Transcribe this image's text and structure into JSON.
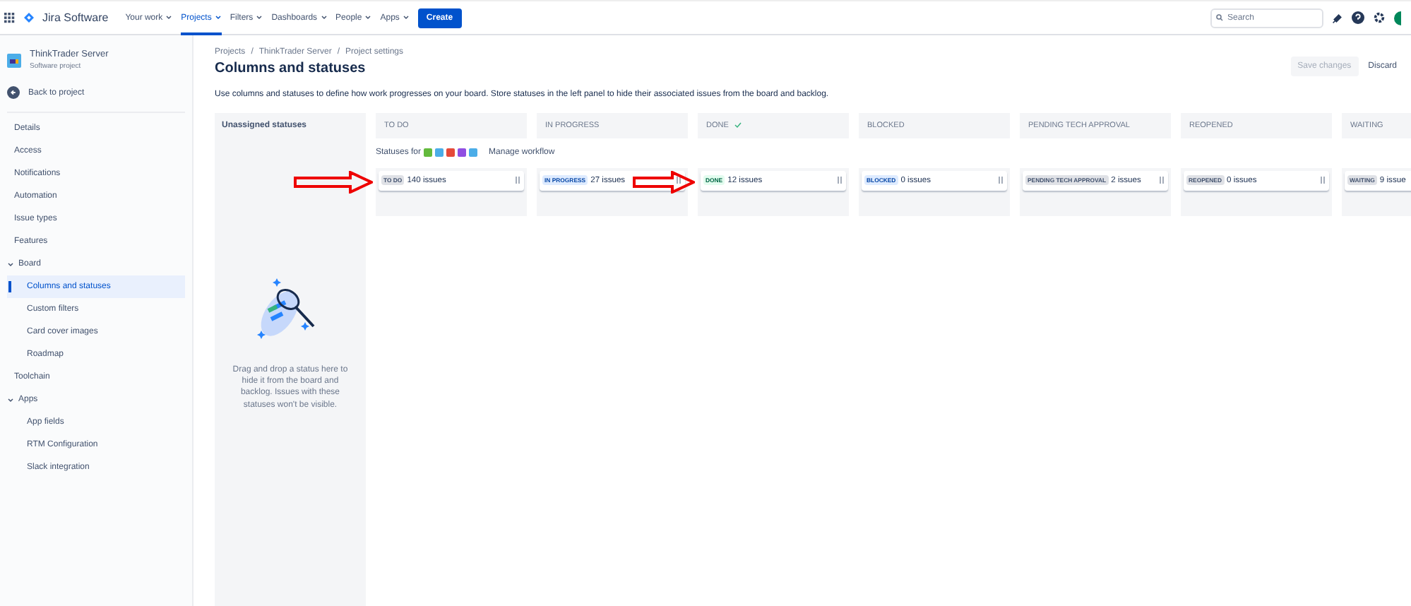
{
  "topnav": {
    "product": "Jira Software",
    "menus": [
      {
        "label": "Your work",
        "selected": false
      },
      {
        "label": "Projects",
        "selected": true
      },
      {
        "label": "Filters",
        "selected": false
      },
      {
        "label": "Dashboards",
        "selected": false
      },
      {
        "label": "People",
        "selected": false
      },
      {
        "label": "Apps",
        "selected": false
      }
    ],
    "create": "Create",
    "search": {
      "placeholder": "Search"
    }
  },
  "sidebar": {
    "project": {
      "name": "ThinkTrader Server",
      "type": "Software project"
    },
    "back": "Back to project",
    "items": [
      {
        "label": "Details",
        "selected": false
      },
      {
        "label": "Access",
        "selected": false
      },
      {
        "label": "Notifications",
        "selected": false
      },
      {
        "label": "Automation",
        "selected": false
      },
      {
        "label": "Issue types",
        "selected": false
      },
      {
        "label": "Features",
        "selected": false
      },
      {
        "label": "Board",
        "selected": false,
        "expanded": true,
        "children": [
          {
            "label": "Columns and statuses",
            "selected": true
          },
          {
            "label": "Custom filters",
            "selected": false
          },
          {
            "label": "Card cover images",
            "selected": false
          },
          {
            "label": "Roadmap",
            "selected": false
          }
        ]
      },
      {
        "label": "Toolchain",
        "selected": false
      },
      {
        "label": "Apps",
        "selected": false,
        "expanded": true,
        "children": [
          {
            "label": "App fields",
            "selected": false
          },
          {
            "label": "RTM Configuration",
            "selected": false
          },
          {
            "label": "Slack integration",
            "selected": false
          }
        ]
      }
    ]
  },
  "breadcrumbs": [
    "Projects",
    "/",
    "ThinkTrader Server",
    "/",
    "Project settings"
  ],
  "title": "Columns and statuses",
  "actions": {
    "save": {
      "label": "Save changes",
      "disabled": true
    },
    "discard": "Discard"
  },
  "description": "Use columns and statuses to define how work progresses on your board. Store statuses in the left panel to hide their associated issues from the board and backlog.",
  "unassigned": {
    "title": "Unassigned statuses",
    "hint": "Drag and drop a status here to hide it from the board and backlog. Issues with these statuses won't be visible."
  },
  "statuses_for": {
    "label": "Statuses for",
    "issue_types": [
      {
        "color": "#63ba3c"
      },
      {
        "color": "#4bade8"
      },
      {
        "color": "#e5493a"
      },
      {
        "color": "#904ee2"
      },
      {
        "color": "#4bade8"
      }
    ],
    "link": "Manage workflow"
  },
  "columns": [
    {
      "name": "TO DO",
      "done": false,
      "status": "TO DO",
      "kind": "default",
      "count": "140 issues"
    },
    {
      "name": "IN PROGRESS",
      "done": false,
      "status": "IN PROGRESS",
      "kind": "progress",
      "count": "27 issues"
    },
    {
      "name": "DONE",
      "done": true,
      "status": "DONE",
      "kind": "success",
      "count": "12 issues"
    },
    {
      "name": "BLOCKED",
      "done": false,
      "status": "BLOCKED",
      "kind": "progress",
      "count": "0 issues"
    },
    {
      "name": "PENDING TECH APPROVAL",
      "done": false,
      "status": "PENDING TECH APPROVAL",
      "kind": "default",
      "count": "2 issues"
    },
    {
      "name": "REOPENED",
      "done": false,
      "status": "REOPENED",
      "kind": "default",
      "count": "0 issues"
    },
    {
      "name": "WAITING",
      "done": false,
      "status": "WAITING",
      "kind": "default",
      "count": "9 issue"
    }
  ],
  "annotations": [
    {
      "kind": "arrow"
    },
    {
      "kind": "arrow"
    }
  ]
}
